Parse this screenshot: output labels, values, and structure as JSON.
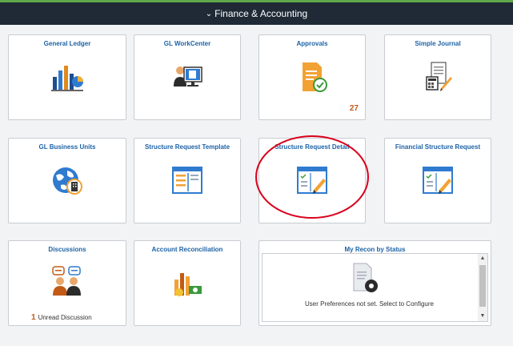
{
  "header": {
    "title": "Finance & Accounting",
    "chevron_icon": "chevron-down-icon"
  },
  "tiles": [
    {
      "title": "General Ledger",
      "icon": "bar-chart-icon"
    },
    {
      "title": "GL WorkCenter",
      "icon": "user-monitor-icon"
    },
    {
      "title": "Approvals",
      "icon": "approval-document-icon",
      "badge": "27"
    },
    {
      "title": "Simple Journal",
      "icon": "journal-calculator-icon"
    },
    {
      "title": "GL Business Units",
      "icon": "globe-building-icon"
    },
    {
      "title": "Structure Request Template",
      "icon": "form-template-icon"
    },
    {
      "title": "Structure Request Detail",
      "icon": "form-edit-icon"
    },
    {
      "title": "Financial Structure Request",
      "icon": "form-edit-icon"
    },
    {
      "title": "Discussions",
      "icon": "chat-people-icon",
      "count": "1",
      "count_label": "Unread Discussion"
    },
    {
      "title": "Account Reconciliation",
      "icon": "reconciliation-chart-icon"
    }
  ],
  "recon": {
    "title": "My Recon by Status",
    "message": "User Preferences not set. Select to Configure",
    "icon": "settings-document-icon"
  },
  "colors": {
    "header_bg": "#1f2a36",
    "accent_green": "#5fa84a",
    "title_blue": "#1c62a6",
    "badge_orange": "#c25a16",
    "annotation_red": "#d9001b"
  }
}
